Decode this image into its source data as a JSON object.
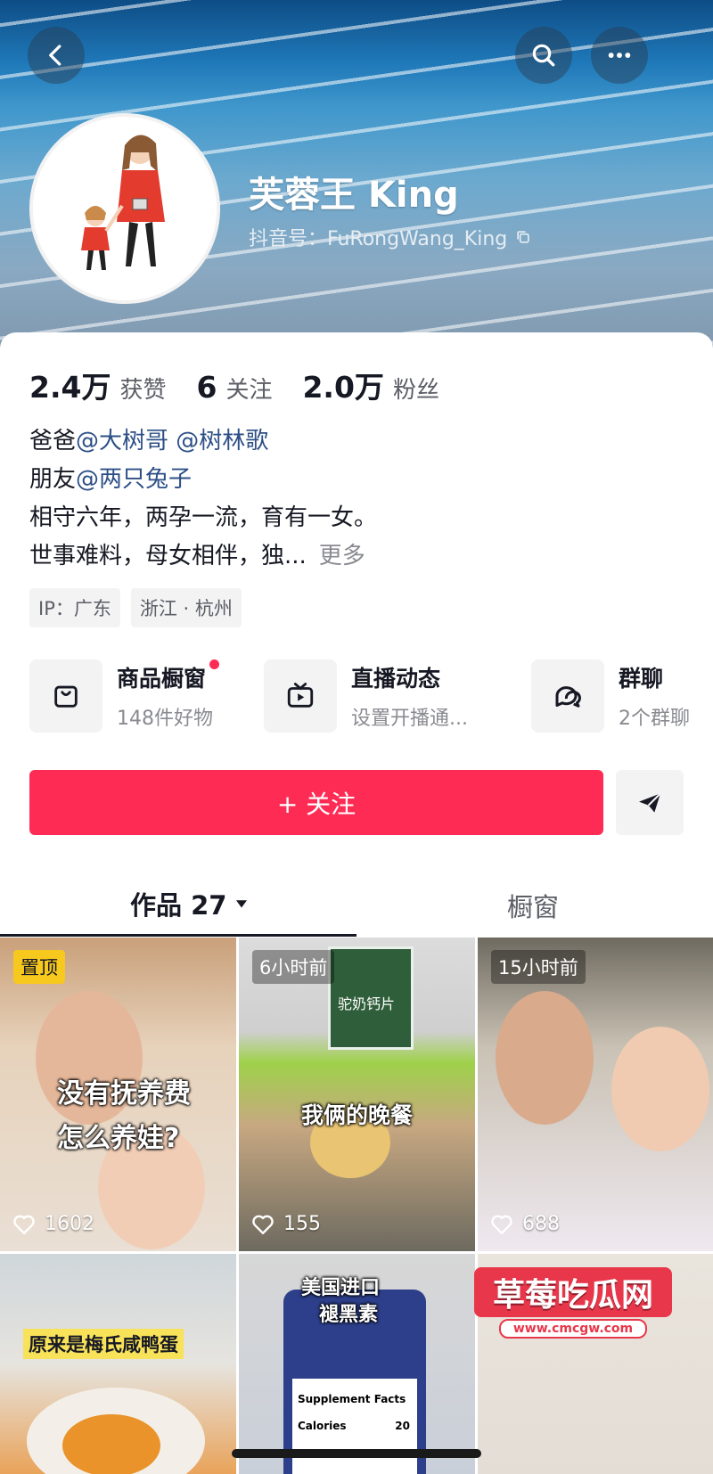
{
  "profile": {
    "name": "芙蓉王 King",
    "douyin_id": "抖音号：FuRongWang_King"
  },
  "stats": [
    {
      "value": "2.4万",
      "label": "获赞"
    },
    {
      "value": "6",
      "label": "关注"
    },
    {
      "value": "2.0万",
      "label": "粉丝"
    }
  ],
  "bio": {
    "line1_prefix": "爸爸",
    "line1_mention1": "@大树哥",
    "line1_mention2": "@树林歌",
    "line2_prefix": "朋友",
    "line2_mention": "@两只兔子",
    "line3": "相守六年，两孕一流，育有一女。",
    "line4": "世事难料，母女相伴，独...",
    "more": "更多"
  },
  "tags": [
    "IP：广东",
    "浙江 · 杭州"
  ],
  "features": [
    {
      "title": "商品橱窗",
      "subtitle": "148件好物",
      "icon": "bag-icon"
    },
    {
      "title": "直播动态",
      "subtitle": "设置开播通...",
      "icon": "tv-icon"
    },
    {
      "title": "群聊",
      "subtitle": "2个群聊",
      "icon": "chat-icon"
    }
  ],
  "actions": {
    "follow": "+ 关注",
    "share_icon": "send-icon"
  },
  "tabs": {
    "works": "作品 27",
    "showcase": "橱窗"
  },
  "videos": [
    {
      "badge": "置顶",
      "likes": "1602",
      "caption1": "没有抚养费",
      "caption2": "怎么养娃?"
    },
    {
      "badge": "6小时前",
      "likes": "155",
      "caption1": "我俩的晚餐",
      "label": "驼奶钙片"
    },
    {
      "badge": "15小时前",
      "likes": "688"
    },
    {
      "caption1": "原来是梅氏咸鸭蛋"
    },
    {
      "caption1": "美国进口",
      "caption2": "褪黑素",
      "label1": "Supplement Facts",
      "label2": "Calories",
      "label3": "20"
    },
    {}
  ],
  "watermark": {
    "title": "草莓吃瓜网",
    "url": "www.cmcgw.com"
  },
  "colors": {
    "accent": "#fe2c55",
    "mention": "#2d4f86",
    "pin_badge": "#f7c81e"
  }
}
